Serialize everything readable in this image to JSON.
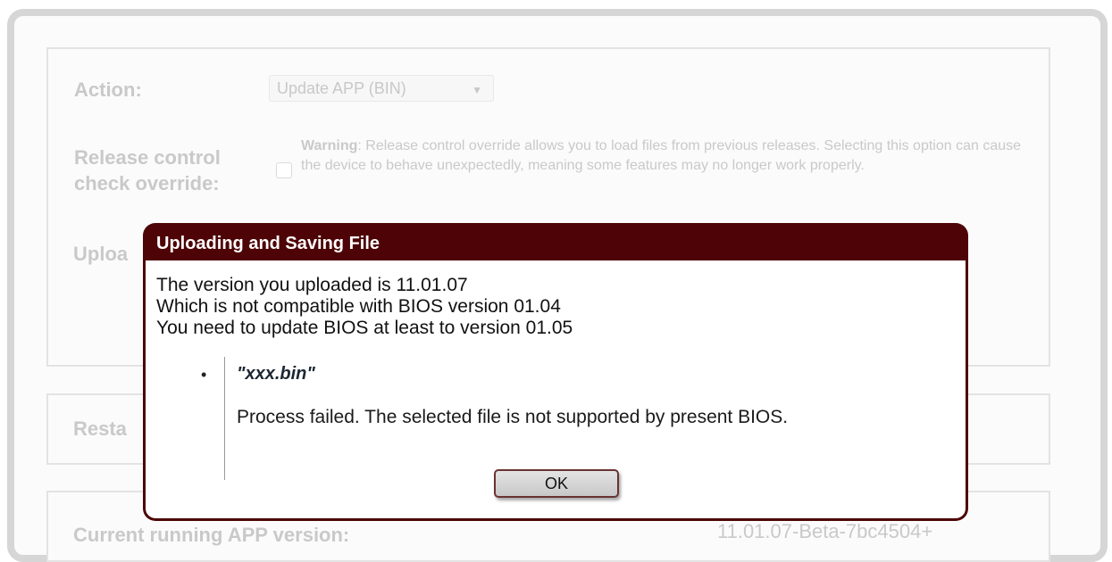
{
  "background": {
    "action_label": "Action:",
    "action_select_value": "Update APP (BIN)",
    "release_label": "Release control check override:",
    "warning_bold": "Warning",
    "warning_text": ": Release control override allows you to load files from previous releases. Selecting this option can cause the device to behave unexpectedly, meaning some features may no longer work properly.",
    "upload_label": "Uploa",
    "restart_label": "Resta",
    "current_version_label": "Current running APP version:",
    "current_version_value": "11.01.07-Beta-7bc4504+"
  },
  "dialog": {
    "title": "Uploading and Saving File",
    "message_lines": [
      "The version you uploaded is 11.01.07",
      "Which is not compatible with BIOS version 01.04",
      "You need to update BIOS at least to version 01.05"
    ],
    "bullet": "•",
    "file_name": "\"xxx.bin\"",
    "result_text": "Process failed. The selected file is not supported by present BIOS.",
    "ok_label": "OK"
  },
  "colors": {
    "dialog_header": "#4e0406",
    "faded_text": "#c9c9c9"
  }
}
